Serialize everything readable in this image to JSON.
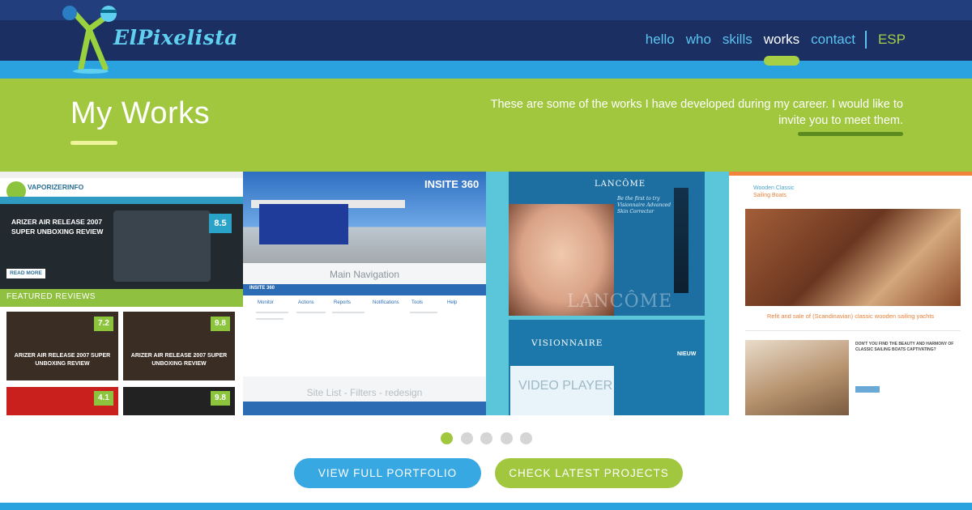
{
  "header": {
    "logo_text": "ElPixelista",
    "nav": [
      {
        "label": "hello"
      },
      {
        "label": "who"
      },
      {
        "label": "skills"
      },
      {
        "label": "works",
        "active": true
      },
      {
        "label": "contact"
      }
    ],
    "language": "ESP"
  },
  "hero": {
    "title": "My Works",
    "subtitle": "These are some of the works I have developed during my career. I would like to invite you to meet them."
  },
  "slides": {
    "vaporizer": {
      "logo": "VAPORIZERINFO",
      "feature_title": "ARIZER AIR RELEASE 2007 SUPER UNBOXING REVIEW",
      "feature_score": "8.5",
      "read_more": "READ MORE",
      "featured_label": "FEATURED REVIEWS",
      "tiles": [
        {
          "title": "ARIZER AIR RELEASE 2007 SUPER UNBOXING REVIEW",
          "score": "7.2"
        },
        {
          "title": "ARIZER AIR RELEASE 2007 SUPER UNBOXING REVIEW",
          "score": "9.8"
        },
        {
          "score": "4.1"
        },
        {
          "score": "9.8"
        }
      ]
    },
    "insite": {
      "logo": "INSITE 360",
      "title": "Main Navigation",
      "bar_label": "INSITE 360",
      "columns": [
        "Monitor",
        "Actions",
        "Reports",
        "Notifications",
        "Tools",
        "Help"
      ],
      "subtitle": "Site List - Filters - redesign"
    },
    "lancome": {
      "brand": "LANCÔME",
      "tagline": "Be the first to try Visionnaire Advanced Skin Corrector",
      "watermark": "LANCÔME",
      "visionnaire": "VISIONNAIRE",
      "video": "VIDEO PLAYER",
      "badge": "NIEUW"
    },
    "boats": {
      "logo_line1": "Wooden Classic",
      "logo_line2": "Sailing Boats",
      "caption": "Refit and sale of (Scandinavian) classic wooden sailing yachts",
      "text": "DON'T YOU FIND THE BEAUTY AND HARMONY OF CLASSIC SAILING BOATS CAPTIVATING?"
    }
  },
  "pager": {
    "count": 5,
    "active_index": 0
  },
  "buttons": {
    "portfolio": "VIEW FULL PORTFOLIO",
    "latest": "CHECK LATEST PROJECTS"
  },
  "colors": {
    "navy": "#1b2f62",
    "blue": "#2aa2e0",
    "green": "#a1c73f"
  }
}
